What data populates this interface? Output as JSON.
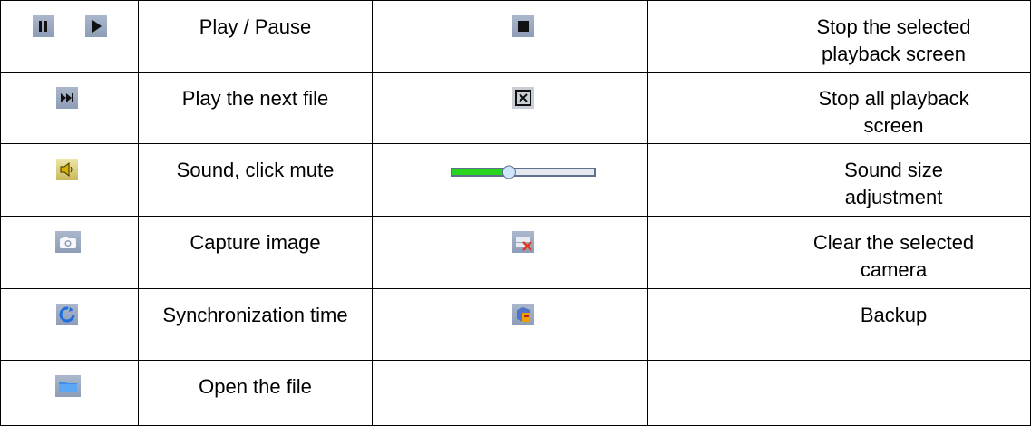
{
  "rows": [
    {
      "left_icons": [
        "pause-icon",
        "play-icon"
      ],
      "left_label": "Play / Pause",
      "right_icons": [
        "stop-icon"
      ],
      "right_label": [
        "Stop the selected",
        "playback screen"
      ]
    },
    {
      "left_icons": [
        "next-file-icon"
      ],
      "left_label": "Play the next file",
      "right_icons": [
        "stop-all-icon"
      ],
      "right_label": [
        "Stop all playback",
        "screen"
      ]
    },
    {
      "left_icons": [
        "speaker-icon"
      ],
      "left_label": "Sound, click mute",
      "right_icons": [
        "volume-slider"
      ],
      "right_label": [
        "Sound size",
        "adjustment"
      ]
    },
    {
      "left_icons": [
        "camera-icon"
      ],
      "left_label": "Capture image",
      "right_icons": [
        "clear-camera-icon"
      ],
      "right_label": [
        "Clear the selected",
        "camera"
      ]
    },
    {
      "left_icons": [
        "sync-time-icon"
      ],
      "left_label": "Synchronization time",
      "right_icons": [
        "backup-icon"
      ],
      "right_label": [
        "Backup"
      ]
    },
    {
      "left_icons": [
        "folder-icon"
      ],
      "left_label": "Open the file",
      "right_icons": [],
      "right_label": []
    }
  ],
  "volume_level": 0.4,
  "colors": {
    "icon_bg": "#9aa8c1",
    "glyph": "#111111",
    "slider_green": "#28d41e",
    "mute_x": "#e23a1a"
  }
}
